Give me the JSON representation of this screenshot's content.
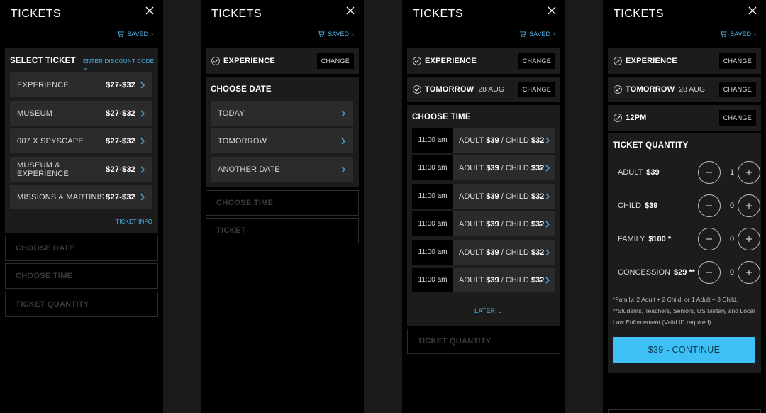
{
  "header": {
    "title": "TICKETS",
    "saved_label": "SAVED"
  },
  "panel1": {
    "section_title": "SELECT TICKET",
    "discount_link": "ENTER DISCOUNT CODE",
    "tickets": [
      {
        "label": "EXPERIENCE",
        "price": "$27-$32"
      },
      {
        "label": "MUSEUM",
        "price": "$27-$32"
      },
      {
        "label": "007 X SPYSCAPE",
        "price": "$27-$32"
      },
      {
        "label": "MUSEUM & EXPERIENCE",
        "price": "$27-$32"
      },
      {
        "label": "MISSIONS & MARTINIS",
        "price": "$27-$32"
      }
    ],
    "ticket_info": "TICKET INFO",
    "steps": [
      "CHOOSE DATE",
      "CHOOSE TIME",
      "TICKET QUANTITY"
    ]
  },
  "panel2": {
    "selected": {
      "label": "EXPERIENCE",
      "change": "CHANGE"
    },
    "section_title": "CHOOSE DATE",
    "dates": [
      "TODAY",
      "TOMORROW",
      "ANOTHER DATE"
    ],
    "steps": [
      "CHOOSE TIME",
      "TICKET"
    ]
  },
  "panel3": {
    "selected": [
      {
        "label": "EXPERIENCE",
        "sub": "",
        "change": "CHANGE"
      },
      {
        "label": "TOMORROW",
        "sub": "28 AUG",
        "change": "CHANGE"
      }
    ],
    "section_title": "CHOOSE TIME",
    "times": [
      {
        "time": "11:00 am",
        "adult_label": "ADULT",
        "adult_price": "$39",
        "sep": "/",
        "child_label": "CHILD",
        "child_price": "$32"
      },
      {
        "time": "11:00 am",
        "adult_label": "ADULT",
        "adult_price": "$39",
        "sep": "/",
        "child_label": "CHILD",
        "child_price": "$32"
      },
      {
        "time": "11:00 am",
        "adult_label": "ADULT",
        "adult_price": "$39",
        "sep": "/",
        "child_label": "CHILD",
        "child_price": "$32"
      },
      {
        "time": "11:00 am",
        "adult_label": "ADULT",
        "adult_price": "$39",
        "sep": "/",
        "child_label": "CHILD",
        "child_price": "$32"
      },
      {
        "time": "11:00 am",
        "adult_label": "ADULT",
        "adult_price": "$39",
        "sep": "/",
        "child_label": "CHILD",
        "child_price": "$32"
      },
      {
        "time": "11:00 am",
        "adult_label": "ADULT",
        "adult_price": "$39",
        "sep": "/",
        "child_label": "CHILD",
        "child_price": "$32"
      }
    ],
    "later_link": "LATER",
    "steps": [
      "TICKET QUANTITY"
    ]
  },
  "panel4": {
    "selected": [
      {
        "label": "EXPERIENCE",
        "sub": "",
        "change": "CHANGE"
      },
      {
        "label": "TOMORROW",
        "sub": "28 AUG",
        "change": "CHANGE"
      },
      {
        "label": "12PM",
        "sub": "",
        "change": "CHANGE"
      }
    ],
    "section_title": "TICKET QUANTITY",
    "quantities": [
      {
        "label": "ADULT",
        "price": "$39",
        "value": "1"
      },
      {
        "label": "CHILD",
        "price": "$39",
        "value": "0"
      },
      {
        "label": "FAMILY",
        "price": "$100 *",
        "value": "0"
      },
      {
        "label": "CONCESSION",
        "price": "$29 **",
        "value": "0"
      }
    ],
    "note1": "*Family: 2 Adult + 2 Child, or 1 Adult + 3 Child.",
    "note2": "**Students, Teachers, Seniors, US Military and Local Law Enforcement (Valid ID required)",
    "cta": "$39 - CONTINUE"
  },
  "colors": {
    "accent": "#3fc0f5",
    "link": "#4fb3ea",
    "card": "#1c1c1c",
    "button": "#2b2b2b"
  }
}
